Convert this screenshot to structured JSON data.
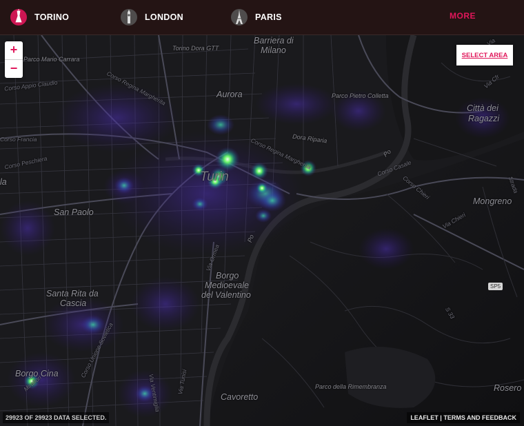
{
  "topbar": {
    "cities": [
      {
        "label": "TORINO",
        "icon": "torino-mole-icon"
      },
      {
        "label": "LONDON",
        "icon": "london-bigben-icon"
      },
      {
        "label": "PARIS",
        "icon": "paris-eiffel-icon"
      }
    ],
    "more_label": "MORE"
  },
  "controls": {
    "zoom_in": "+",
    "zoom_out": "−",
    "select_area": "SELECT AREA"
  },
  "status": "29923 OF 29923 DATA SELECTED.",
  "attribution": "LEAFLET | TERMS AND FEEDBACK",
  "colors": {
    "accent": "#e0165a",
    "heat_low": "#3a1f8a",
    "heat_high": "#6dff6a",
    "topbar": "#241414"
  },
  "map_labels": {
    "torino_dora": "Torino Dora GTT",
    "barriera": "Barriera di",
    "milano": "Milano",
    "parco_mario_carrara": "Parco Mario Carrara",
    "corso_appio_claudio": "Corso Appio Claudio",
    "corso_regina_margherita": "Corso Regina Margherita",
    "aurora": "Aurora",
    "parco_pietro_colletta": "Parco Pietro Colletta",
    "citta_dei": "Città dei",
    "ragazzi": "Ragazzi",
    "corso_francia": "Corso Francia",
    "dora_riparia": "Dora Riparia",
    "corso_peschiera": "Corso Peschiera",
    "turin": "Turin",
    "san_paolo": "San Paolo",
    "mongreno": "Mongreno",
    "borgo": "Borgo",
    "medioevale": "Medioevale",
    "del_valentino": "del Valentino",
    "santa_rita_da": "Santa Rita da",
    "cascia": "Cascia",
    "borgo_cina": "Borgo Cina",
    "parco_rimembranza": "Parco della Rimembranza",
    "cavoretto": "Cavoretto",
    "rosero": "Rosero",
    "via_ormea": "Via Ormea",
    "corso_casale": "Corso Casale",
    "corso_chieri": "Corso Chieri",
    "via_chieri": "Via Chieri",
    "corso_unione_sovietica": "Corso Unione Sovietica",
    "sp5": "SP5",
    "s33": "S 33",
    "po1": "Po",
    "po2": "Po",
    "strada": "Strada",
    "via_cfr": "Via Cfr",
    "via": "Via",
    "la": "la",
    "corso_regina_margherita2": "Corso Regina Margherita",
    "via_ventimiglia": "Via Ventimiglia",
    "via_tunisi": "Via Tunisi",
    "mirafiori": "Mirafiori"
  }
}
